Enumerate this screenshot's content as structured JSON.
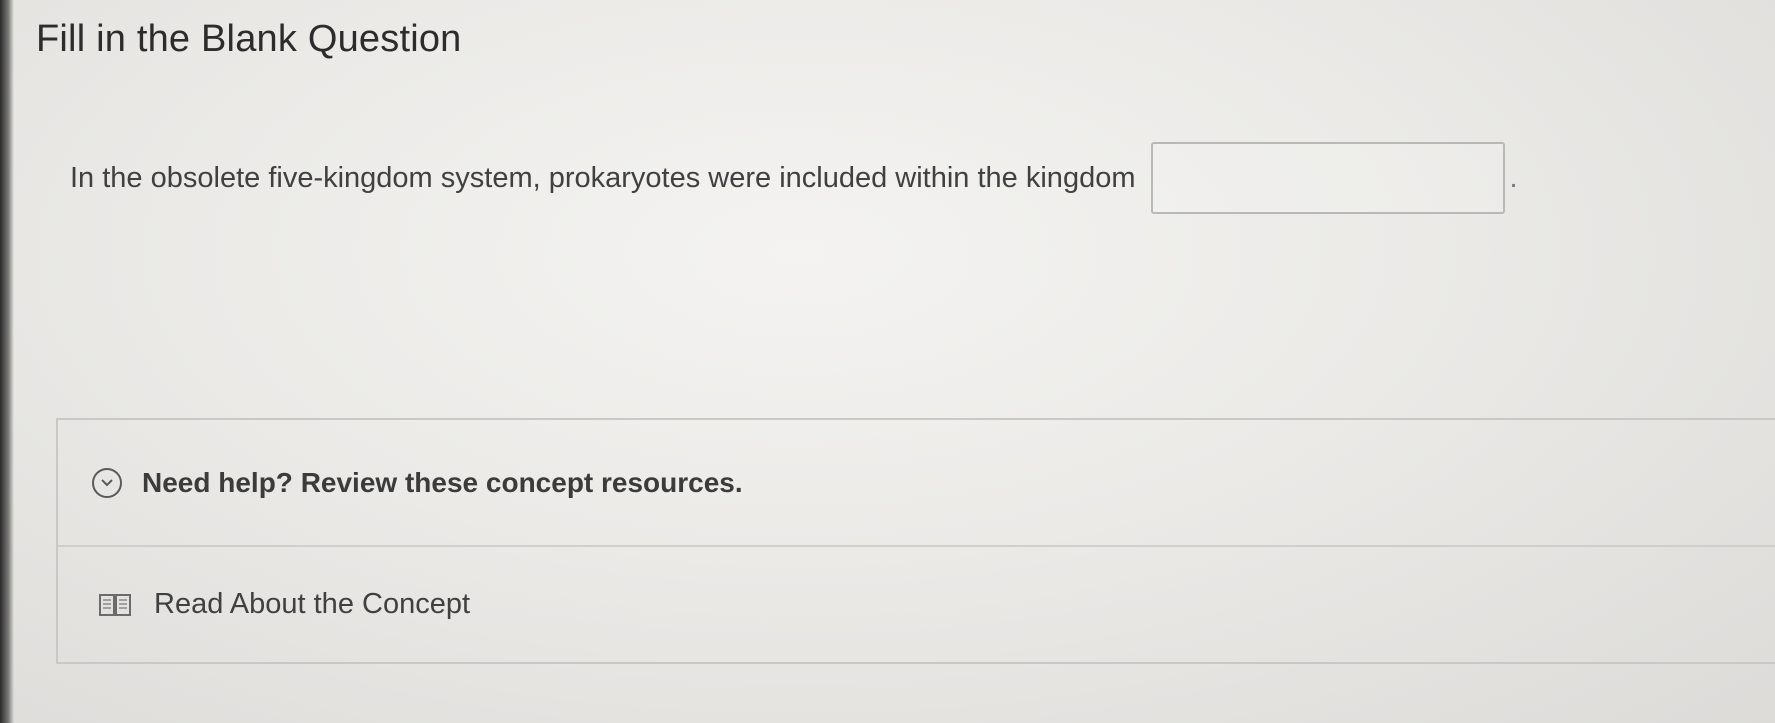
{
  "page": {
    "title": "Fill in the Blank Question"
  },
  "question": {
    "text": "In the obsolete five-kingdom system, prokaryotes were included within the kingdom",
    "blank_value": "",
    "end_punctuation": "."
  },
  "resources": {
    "toggle_icon": "chevron-down-circle-icon",
    "help_label": "Need help? Review these concept resources.",
    "items": [
      {
        "icon": "book-icon",
        "label": "Read About the Concept"
      }
    ]
  },
  "colors": {
    "background": "#ebeae7",
    "text": "#3a3a3a",
    "border": "#c9c8c5"
  }
}
